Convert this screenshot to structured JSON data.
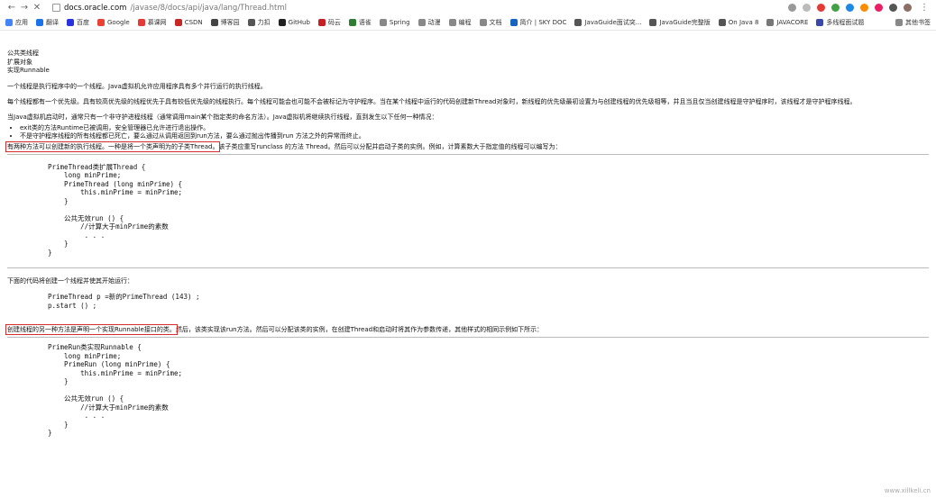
{
  "browser": {
    "url_host": "docs.oracle.com",
    "url_path": "/javase/8/docs/api/java/lang/Thread.html",
    "bookmarks": [
      "应用",
      "翻译",
      "百度",
      "Google",
      "慕课网",
      "CSDN",
      "博客园",
      "力扣",
      "GitHub",
      "码云",
      "语雀",
      "Spring",
      "动漫",
      "编程",
      "文档",
      "简介 | SKY DOC",
      "JavaGuide面试突...",
      "JavaGuide完整版",
      "On Java 8",
      "JAVACORE",
      "多线程面试题"
    ],
    "bookmarks_right": "其他书签"
  },
  "doc": {
    "header": [
      "公共类线程",
      "扩展对象",
      "实现Runnable"
    ],
    "p1": "一个线程是执行程序中的一个线程。Java虚拟机允许应用程序具有多个并行运行的执行线程。",
    "p2": "每个线程都有一个优先级。具有较高优先级的线程优先于具有较低优先级的线程执行。每个线程可能会也可能不会被标记为守护程序。当在某个线程中运行的代码创建新Thread对象时，新线程的优先级最初设置为与创建线程的优先级相等，并且当且仅当创建线程是守护程序时，该线程才是守护程序线程。",
    "p3": "当Java虚拟机启动时，通常只有一个非守护进程线程（通常调用main某个指定类的命名方法）。Java虚拟机将继续执行线程，直到发生以下任何一种情况：",
    "bullets": [
      "exit类的方法Runtime已被调用，安全管理器已允许进行退出操作。",
      "不是守护程序线程的所有线程都已死亡，要么通过从调用返回到run方法，要么通过抛出传播到run 方法之外的异常而终止。"
    ],
    "p4_hl": "有两种方法可以创建新的执行线程。一种是将一个类声明为的子类Thread。",
    "p4_rest": "该子类应重写runclass 的方法 Thread。然后可以分配并启动子类的实例。例如，计算素数大于指定值的线程可以编写为：",
    "code1": "PrimeThread类扩展Thread {\n    long minPrime;\n    PrimeThread (long minPrime) {\n        this.minPrime = minPrime;\n    }\n\n    公共无效run () {\n        //计算大于minPrime的素数\n         . . .\n    }\n}",
    "p5": "下面的代码将创建一个线程并使其开始运行：",
    "code2": "PrimeThread p =新的PrimeThread (143) ;\np.start () ;",
    "p6_hl": "创建线程的另一种方法是声明一个实现Runnable接口的类。",
    "p6_rest": "然后，该类实现该run方法。然后可以分配该类的实例，在创建Thread和启动时将其作为参数传递，其他样式的相同示例如下所示：",
    "code3": "PrimeRun类实现Runnable {\n    long minPrime;\n    PrimeRun (long minPrime) {\n        this.minPrime = minPrime;\n    }\n\n    公共无效run () {\n        //计算大于minPrime的素数\n         . . .\n    }\n}"
  },
  "watermark": "www.xillkeli.cn"
}
